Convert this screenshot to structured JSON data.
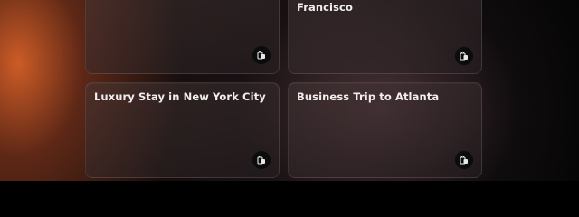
{
  "cards": [
    {
      "title": "",
      "icon": "luggage-icon"
    },
    {
      "title": "Francisco",
      "icon": "luggage-icon"
    },
    {
      "title": "Luxury Stay in New York City",
      "icon": "luggage-icon"
    },
    {
      "title": "Business Trip to Atlanta",
      "icon": "luggage-icon"
    }
  ]
}
